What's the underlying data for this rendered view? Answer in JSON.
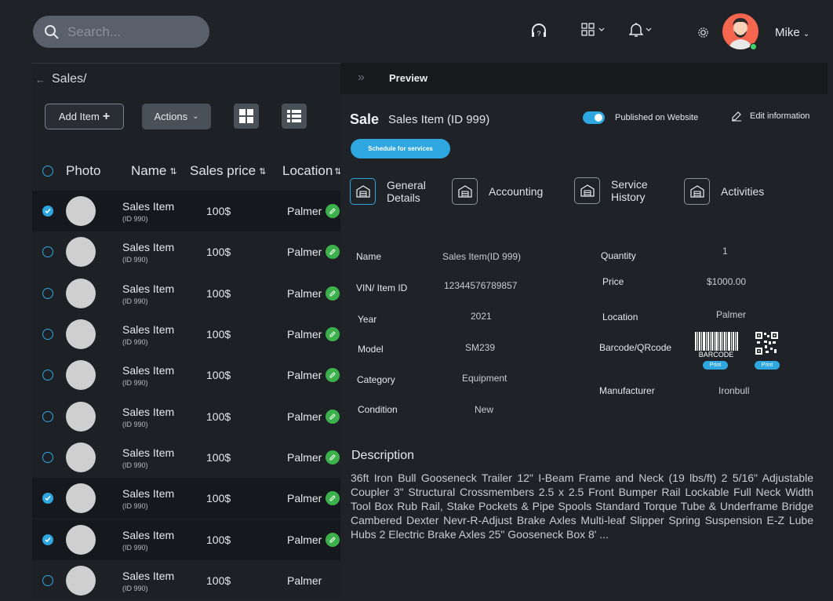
{
  "search": {
    "placeholder": "Search..."
  },
  "user": {
    "name": "Mike"
  },
  "breadcrumb": {
    "label": "Sales/"
  },
  "toolbar": {
    "add_item_label": "Add Item",
    "actions_label": "Actions"
  },
  "table": {
    "headers": {
      "photo": "Photo",
      "name": "Name",
      "price": "Sales price",
      "location": "Location"
    },
    "rows": [
      {
        "name": "Sales Item",
        "id": "(ID 990)",
        "price": "100$",
        "location": "Palmer",
        "checked": true
      },
      {
        "name": "Sales Item",
        "id": "(ID 990)",
        "price": "100$",
        "location": "Palmer",
        "checked": false
      },
      {
        "name": "Sales Item",
        "id": "(ID 990)",
        "price": "100$",
        "location": "Palmer",
        "checked": false
      },
      {
        "name": "Sales Item",
        "id": "(ID 990)",
        "price": "100$",
        "location": "Palmer",
        "checked": false
      },
      {
        "name": "Sales Item",
        "id": "(ID 990)",
        "price": "100$",
        "location": "Palmer",
        "checked": false
      },
      {
        "name": "Sales Item",
        "id": "(ID 990)",
        "price": "100$",
        "location": "Palmer",
        "checked": false
      },
      {
        "name": "Sales Item",
        "id": "(ID 990)",
        "price": "100$",
        "location": "Palmer",
        "checked": false
      },
      {
        "name": "Sales Item",
        "id": "(ID 990)",
        "price": "100$",
        "location": "Palmer",
        "checked": true
      },
      {
        "name": "Sales Item",
        "id": "(ID 990)",
        "price": "100$",
        "location": "Palmer",
        "checked": true
      },
      {
        "name": "Sales Item",
        "id": "(ID 990)",
        "price": "100$",
        "location": "Palmer",
        "checked": false
      }
    ]
  },
  "preview": {
    "header_title": "Preview",
    "sale_title": "Sale",
    "sale_subtitle": "Sales Item (ID 999)",
    "published_label": "Published on Website",
    "published": true,
    "edit_label": "Edit information",
    "schedule_label": "Schedule for services",
    "tabs": [
      {
        "label": "General Details"
      },
      {
        "label": "Accounting"
      },
      {
        "label": "Service History"
      },
      {
        "label": "Activities"
      }
    ],
    "fields_left": [
      {
        "label": "Name",
        "value": "Sales Item(ID 999)"
      },
      {
        "label": "VIN/ Item ID",
        "value": "12344576789857"
      },
      {
        "label": "Year",
        "value": "2021"
      },
      {
        "label": "Model",
        "value": "SM239"
      },
      {
        "label": "Category",
        "value": "Equipment"
      },
      {
        "label": "Condition",
        "value": "New"
      }
    ],
    "fields_right": [
      {
        "label": "Quantity",
        "value": "1"
      },
      {
        "label": "Price",
        "value": "$1000.00"
      },
      {
        "label": "Location",
        "value": "Palmer"
      },
      {
        "label": "Barcode/QRcode",
        "value": ""
      },
      {
        "label": "Manufacturer",
        "value": "Ironbull"
      }
    ],
    "barcode_text": "BARCODE",
    "print_label": "Print",
    "description_title": "Description",
    "description": "36ft Iron Bull Gooseneck Trailer 12\" I-Beam Frame and Neck (19 lbs/ft) 2 5/16\" Adjustable Coupler 3\" Structural Crossmembers 2.5 x 2.5 Front Bumper Rail Lockable Full Neck Width Tool Box Rub Rail, Stake Pockets & Pipe Spools Standard Torque Tube & Underframe Bridge Cambered Dexter Nevr-R-Adjust Brake Axles Multi-leaf Slipper Spring Suspension E-Z Lube Hubs 2 Electric Brake Axles 25\" Gooseneck Box 8' ..."
  },
  "colors": {
    "accent": "#2ea7e0",
    "edit": "#3cb04a",
    "avatar": "#f5664f"
  },
  "icons": [
    "search-icon",
    "headset-icon",
    "apps-grid-icon",
    "bell-icon",
    "gear-icon",
    "chevron-down-icon",
    "plus-icon",
    "grid-view-icon",
    "list-view-icon",
    "sort-icon",
    "pencil-icon",
    "check-icon",
    "garage-icon",
    "expand-icon"
  ]
}
